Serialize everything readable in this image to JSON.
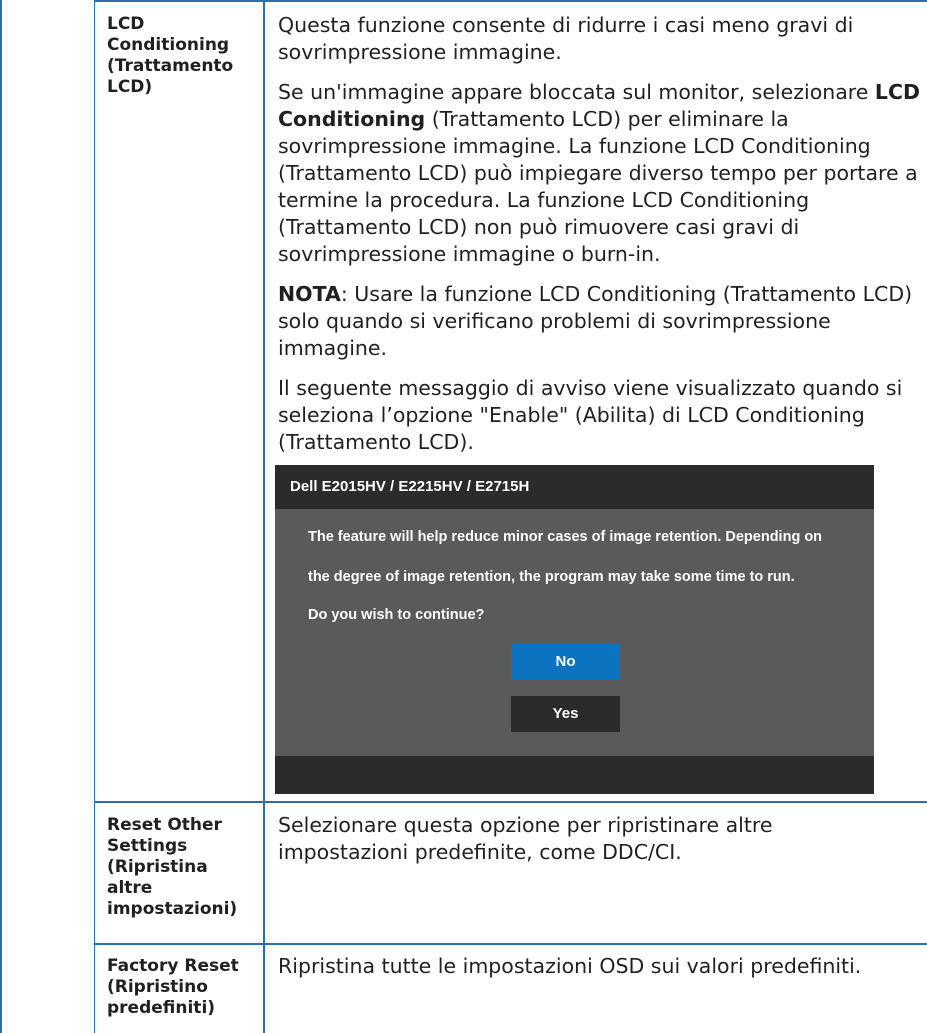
{
  "rows": [
    {
      "term": "LCD Conditioning (Trattamento LCD)",
      "term_lines": [
        "LCD",
        "Conditioning",
        "(Trattamento",
        "LCD)"
      ],
      "intro": "Questa funzione consente di ridurre i casi meno gravi di sovrimpressione immagine.",
      "para2_pre": "Se un'immagine appare bloccata sul monitor, selezionare ",
      "para2_bold": "LCD Conditioning",
      "para2_post": " (Trattamento LCD) per eliminare la sovrimpressione immagine. La funzione LCD Conditioning (Trattamento LCD) può impiegare diverso tempo per portare a termine la procedura. La funzione LCD Conditioning (Trattamento LCD) non può rimuovere casi gravi di sovrimpressione immagine o burn-in.",
      "note_label": "NOTA",
      "note_text": ": Usare la funzione LCD Conditioning (Trattamento LCD) solo quando si verificano problemi di sovrimpressione immagine.",
      "para4": "Il seguente messaggio di avviso viene visualizzato quando si seleziona l’opzione \"Enable\" (Abilita) di LCD Conditioning (Trattamento LCD)."
    },
    {
      "term_lines": [
        "Reset Other",
        "Settings",
        "(Ripristina",
        "altre",
        "impostazioni)"
      ],
      "desc": "Selezionare questa opzione per ripristinare altre impostazioni predefinite, come DDC/CI."
    },
    {
      "term_lines": [
        "Factory Reset",
        "(Ripristino",
        "predefiniti)"
      ],
      "desc": "Ripristina tutte le impostazioni OSD sui valori predefiniti."
    }
  ],
  "dialog": {
    "title": "Dell E2015HV / E2215HV / E2715H",
    "line1": "The feature will help reduce minor cases of image retention. Depending on",
    "line2": "the degree of image retention, the program may take some time to run.",
    "line3": "Do you wish to continue?",
    "no_label": "No",
    "yes_label": "Yes"
  }
}
